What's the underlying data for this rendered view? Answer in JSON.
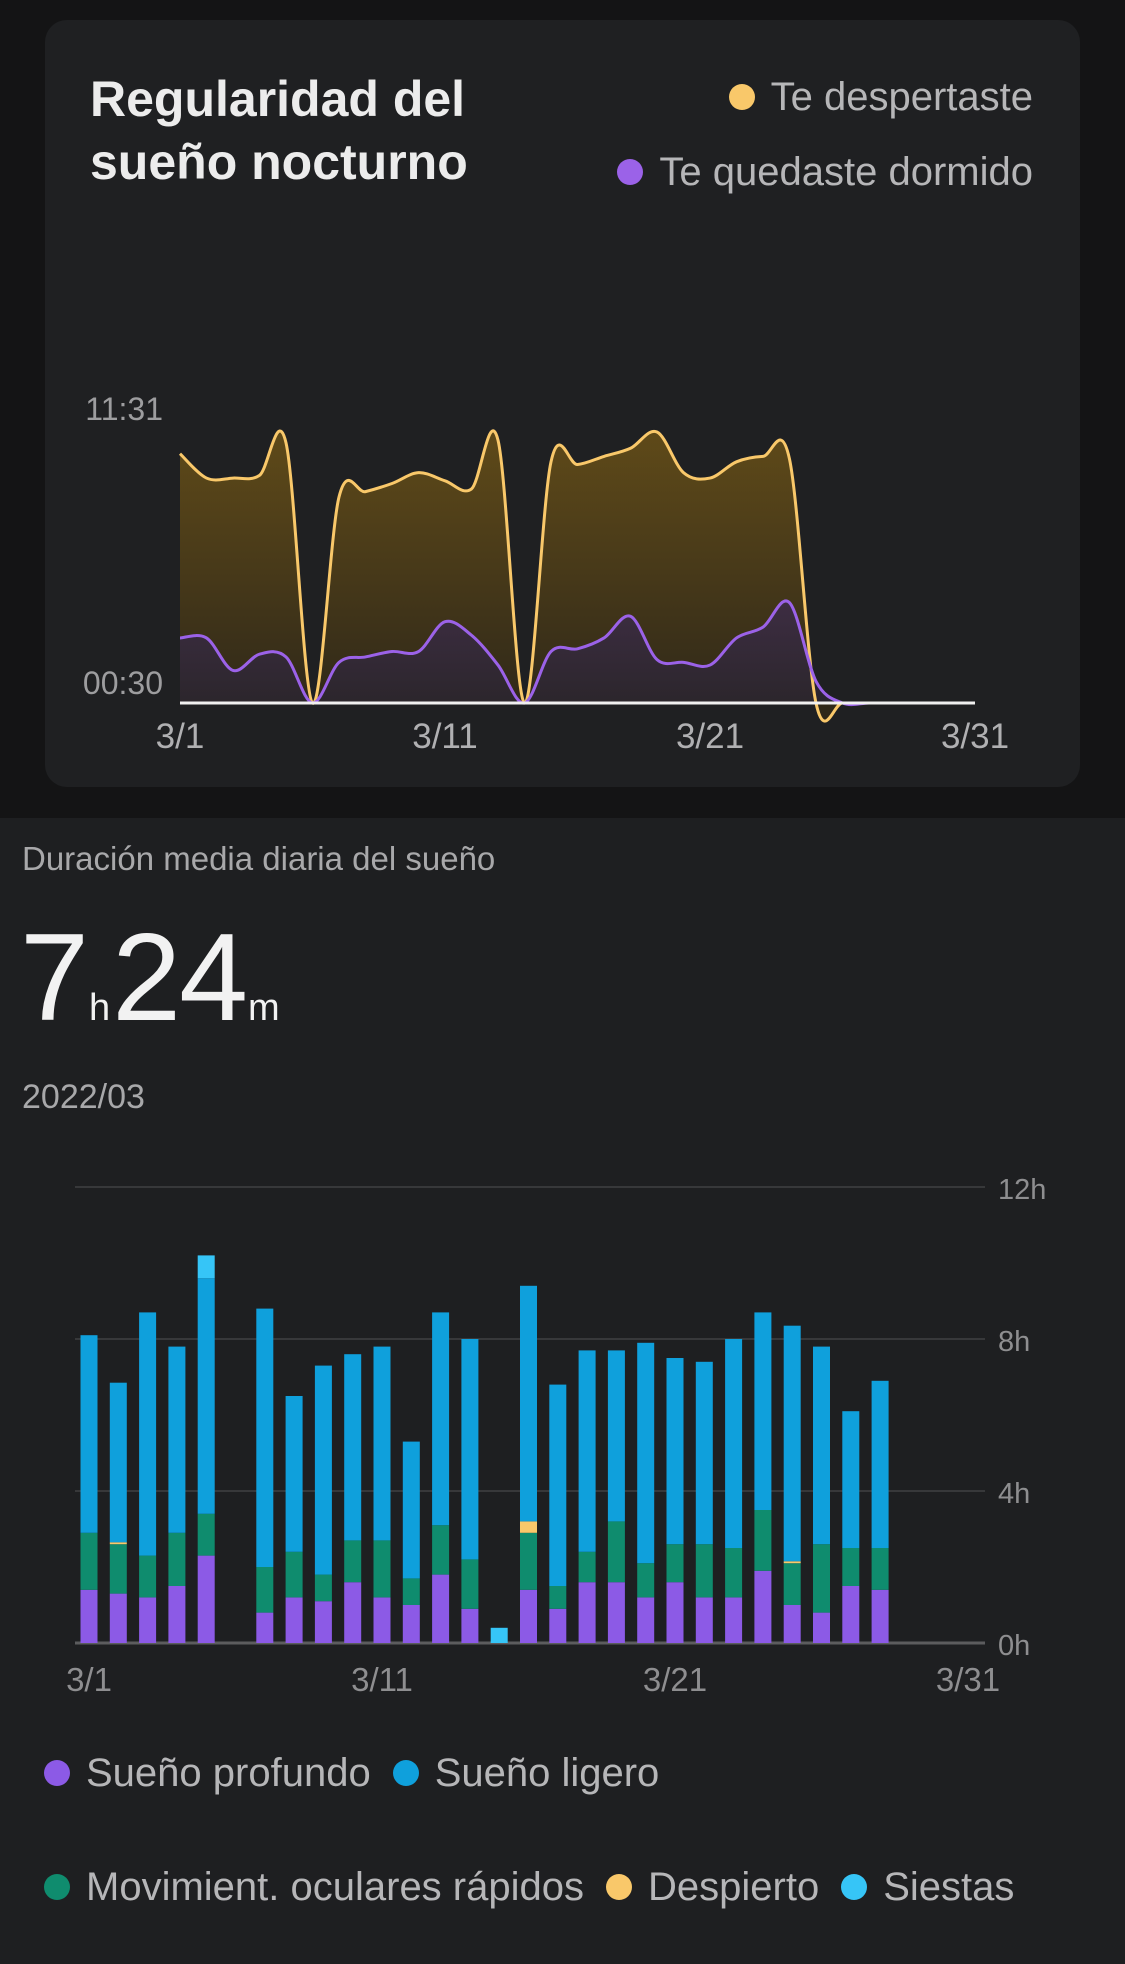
{
  "regularity_card": {
    "title_line1": "Regularidad del",
    "title_line2": "sueño nocturno",
    "legend": [
      {
        "label": "Te despertaste",
        "color": "#f9c86a"
      },
      {
        "label": "Te quedaste dormido",
        "color": "#9b62e8"
      }
    ]
  },
  "summary": {
    "label": "Duración media diaria del sueño",
    "hours": "7",
    "hours_unit": "h",
    "minutes": "24",
    "minutes_unit": "m",
    "period": "2022/03"
  },
  "legend_bottom": [
    {
      "label": "Sueño profundo",
      "color": "#8c5ae6"
    },
    {
      "label": "Sueño ligero",
      "color": "#0fa0dc"
    },
    {
      "label": "Movimient. oculares rápidos",
      "color": "#0f8c6e"
    },
    {
      "label": "Despierto",
      "color": "#f9c86a"
    },
    {
      "label": "Siestas",
      "color": "#36c5f7"
    }
  ],
  "chart_data": [
    {
      "type": "area",
      "title": "Regularidad del sueño nocturno",
      "x_tick_labels": [
        "3/1",
        "3/11",
        "3/21",
        "3/31"
      ],
      "y_tick_labels": [
        "00:30",
        "11:31"
      ],
      "x": [
        1,
        2,
        3,
        4,
        5,
        6,
        7,
        8,
        9,
        10,
        11,
        12,
        13,
        14,
        15,
        16,
        17,
        18,
        19,
        20,
        21,
        22,
        23,
        24,
        25,
        26,
        27,
        28,
        29,
        30,
        31
      ],
      "series": [
        {
          "name": "Te despertaste",
          "color": "#f9c86a",
          "values": [
            0.92,
            0.83,
            0.83,
            0.84,
            0.96,
            0.0,
            0.76,
            0.78,
            0.81,
            0.85,
            0.82,
            0.79,
            0.97,
            0.0,
            0.89,
            0.88,
            0.91,
            0.94,
            1.0,
            0.85,
            0.83,
            0.89,
            0.91,
            0.9,
            0.0,
            0.0,
            0.0,
            0.0,
            0.0,
            0.0,
            0.0
          ]
        },
        {
          "name": "Te quedaste dormido",
          "color": "#9b62e8",
          "values": [
            0.24,
            0.24,
            0.12,
            0.18,
            0.17,
            0.0,
            0.15,
            0.17,
            0.19,
            0.19,
            0.3,
            0.25,
            0.14,
            0.0,
            0.19,
            0.2,
            0.24,
            0.32,
            0.16,
            0.15,
            0.14,
            0.24,
            0.28,
            0.37,
            0.08,
            0.0,
            0.0,
            0.0,
            0.0,
            0.0,
            0.0
          ]
        }
      ]
    },
    {
      "type": "bar",
      "stacked": true,
      "x_tick_labels": [
        "3/1",
        "3/11",
        "3/21",
        "3/31"
      ],
      "y_tick_labels": [
        "0h",
        "4h",
        "8h",
        "12h"
      ],
      "ylim": [
        0,
        12
      ],
      "categories": [
        "3/1",
        "3/2",
        "3/3",
        "3/4",
        "3/5",
        "3/6",
        "3/7",
        "3/8",
        "3/9",
        "3/10",
        "3/11",
        "3/12",
        "3/13",
        "3/14",
        "3/15",
        "3/16",
        "3/17",
        "3/18",
        "3/19",
        "3/20",
        "3/21",
        "3/22",
        "3/23",
        "3/24",
        "3/25",
        "3/26",
        "3/27",
        "3/28",
        "3/29",
        "3/30",
        "3/31"
      ],
      "series": [
        {
          "name": "Sueño profundo",
          "color": "#8c5ae6",
          "values": [
            1.4,
            1.3,
            1.2,
            1.5,
            2.3,
            0,
            0.8,
            1.2,
            1.1,
            1.6,
            1.2,
            1.0,
            1.8,
            0.9,
            0,
            1.4,
            0.9,
            1.6,
            1.6,
            1.2,
            1.6,
            1.2,
            1.2,
            1.9,
            1.0,
            0.8,
            1.5,
            1.4,
            0,
            0,
            0
          ]
        },
        {
          "name": "Movimient. oculares rápidos",
          "color": "#0f8c6e",
          "values": [
            1.5,
            1.3,
            1.1,
            1.4,
            1.1,
            0,
            1.2,
            1.2,
            0.7,
            1.1,
            1.5,
            0.7,
            1.3,
            1.3,
            0,
            1.5,
            0.6,
            0.8,
            1.6,
            0.9,
            1.0,
            1.4,
            1.3,
            1.6,
            1.1,
            1.8,
            1.0,
            1.1,
            0,
            0,
            0
          ]
        },
        {
          "name": "Despierto",
          "color": "#f9c86a",
          "values": [
            0,
            0.05,
            0,
            0,
            0,
            0,
            0,
            0,
            0,
            0,
            0,
            0,
            0,
            0,
            0,
            0.3,
            0,
            0,
            0,
            0,
            0,
            0,
            0,
            0,
            0.05,
            0,
            0,
            0,
            0,
            0,
            0
          ]
        },
        {
          "name": "Sueño ligero",
          "color": "#0fa0dc",
          "values": [
            5.2,
            4.2,
            6.4,
            4.9,
            6.2,
            0,
            6.8,
            4.1,
            5.5,
            4.9,
            5.1,
            3.6,
            5.6,
            5.8,
            0,
            6.2,
            5.3,
            5.3,
            4.5,
            5.8,
            4.9,
            4.8,
            5.5,
            5.2,
            6.2,
            5.2,
            3.6,
            4.4,
            0,
            0,
            0
          ]
        },
        {
          "name": "Siestas",
          "color": "#36c5f7",
          "values": [
            0,
            0,
            0,
            0,
            0.6,
            0,
            0,
            0,
            0,
            0,
            0,
            0,
            0,
            0,
            0.4,
            0,
            0,
            0,
            0,
            0,
            0,
            0,
            0,
            0,
            0,
            0,
            0,
            0,
            0,
            0,
            0
          ]
        }
      ]
    }
  ]
}
